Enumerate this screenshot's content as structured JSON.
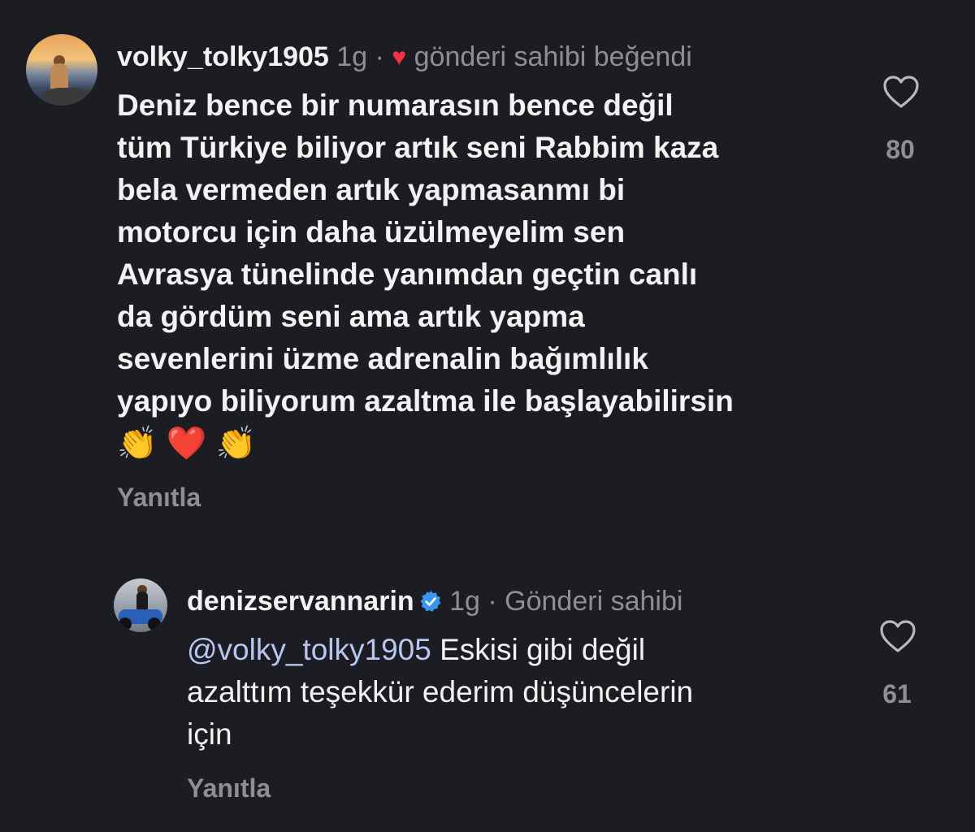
{
  "comment1": {
    "username": "volky_tolky1905",
    "time": "1g",
    "dot": "·",
    "liked_by_owner": "gönderi sahibi beğendi",
    "lines": [
      "Deniz bence bir numarasın bence değil",
      "tüm Türkiye biliyor artık seni Rabbim kaza",
      "bela vermeden artık yapmasanmı bi",
      "motorcu için daha üzülmeyelim sen",
      "Avrasya tünelinde yanımdan geçtin canlı",
      "da gördüm seni ama artık yapma",
      "sevenlerini üzme adrenalin bağımlılık",
      "yapıyo biliyorum azaltma ile başlayabilirsin"
    ],
    "emojis": "👏 ❤️ 👏",
    "reply_label": "Yanıtla",
    "like_count": "80",
    "heart_icon": "heart-outline-icon"
  },
  "comment2": {
    "username": "denizservannarin",
    "verified_icon": "verified-badge-icon",
    "time": "1g",
    "dot": "·",
    "role": "Gönderi sahibi",
    "mention": "@volky_tolky1905",
    "line1_rest": " Eskisi gibi değil",
    "line2": "azalttım teşekkür ederim düşüncelerin",
    "line3": "için",
    "reply_label": "Yanıtla",
    "like_count": "61",
    "heart_icon": "heart-outline-icon"
  },
  "colors": {
    "background": "#1c1d22",
    "text": "#f2f2f2",
    "muted": "#8e8e93",
    "mention": "#b8c7f2",
    "liked_heart": "#ff2d46",
    "verified": "#3897f0"
  }
}
